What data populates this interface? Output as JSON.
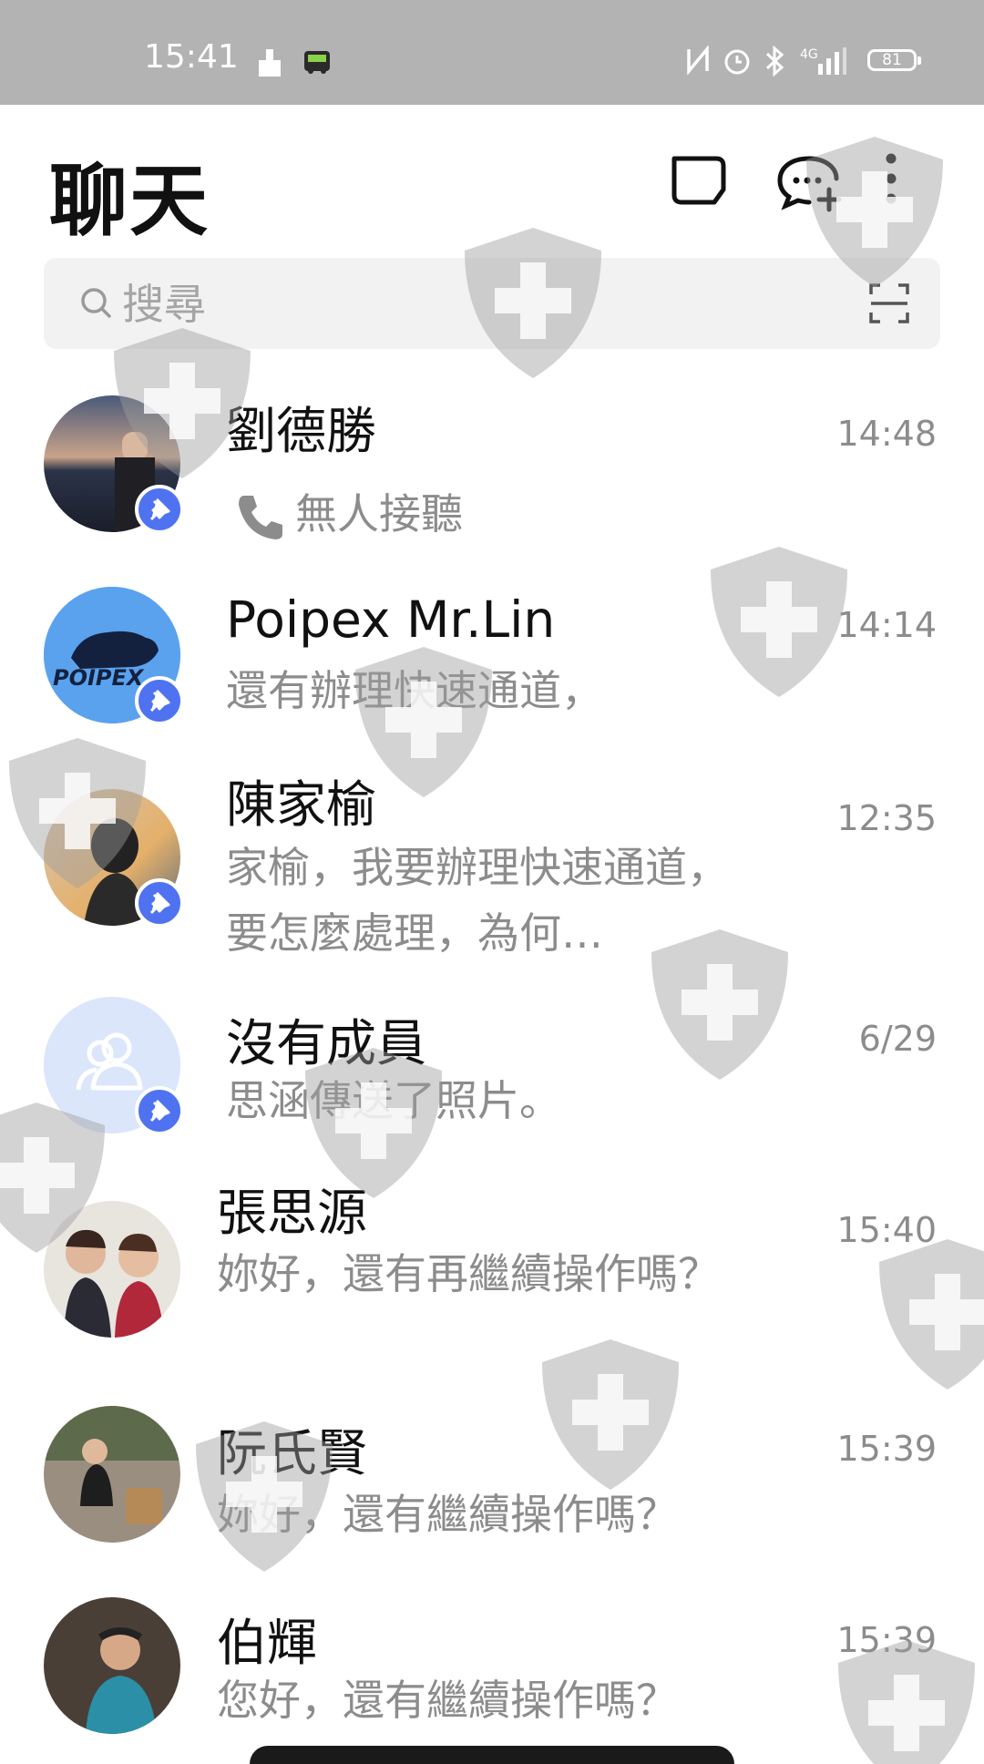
{
  "status_bar": {
    "time": "15:41",
    "network": "4G",
    "battery": "81"
  },
  "header": {
    "title": "聊天"
  },
  "search": {
    "placeholder": "搜尋"
  },
  "chats": [
    {
      "name": "劉德勝",
      "preview": "無人接聽",
      "time": "14:48",
      "pinned": true
    },
    {
      "name": "Poipex  Mr.Lin",
      "preview": "還有辦理快速通道，",
      "time": "14:14",
      "pinned": true,
      "avatar_text": "POIPEX"
    },
    {
      "name": "陳家榆",
      "preview": "家榆，我要辦理快速通道，要怎麼處理，為何…",
      "time": "12:35",
      "pinned": true
    },
    {
      "name": "沒有成員",
      "preview": "思涵傳送了照片。",
      "time": "6/29",
      "pinned": true
    },
    {
      "name": "張思源",
      "preview": "妳好，還有再繼續操作嗎？",
      "time": "15:40",
      "pinned": false
    },
    {
      "name": "阮氏賢",
      "preview": "妳好，還有繼續操作嗎？",
      "time": "15:39",
      "pinned": false
    },
    {
      "name": "伯輝",
      "preview": "您好，還有繼續操作嗎？",
      "time": "15:39",
      "pinned": false
    }
  ],
  "colors": {
    "accent": "#4f73f0",
    "status_bar": "#b3b3b3",
    "muted_text": "#8c8c8c",
    "search_bg": "#f2f2f3"
  },
  "icons": [
    "nfc-icon",
    "alarm-icon",
    "bluetooth-icon",
    "signal-icon",
    "battery-icon",
    "new-note-icon",
    "new-chat-icon",
    "more-icon",
    "search-icon",
    "scan-icon",
    "pin-icon",
    "phone-icon",
    "group-icon"
  ]
}
